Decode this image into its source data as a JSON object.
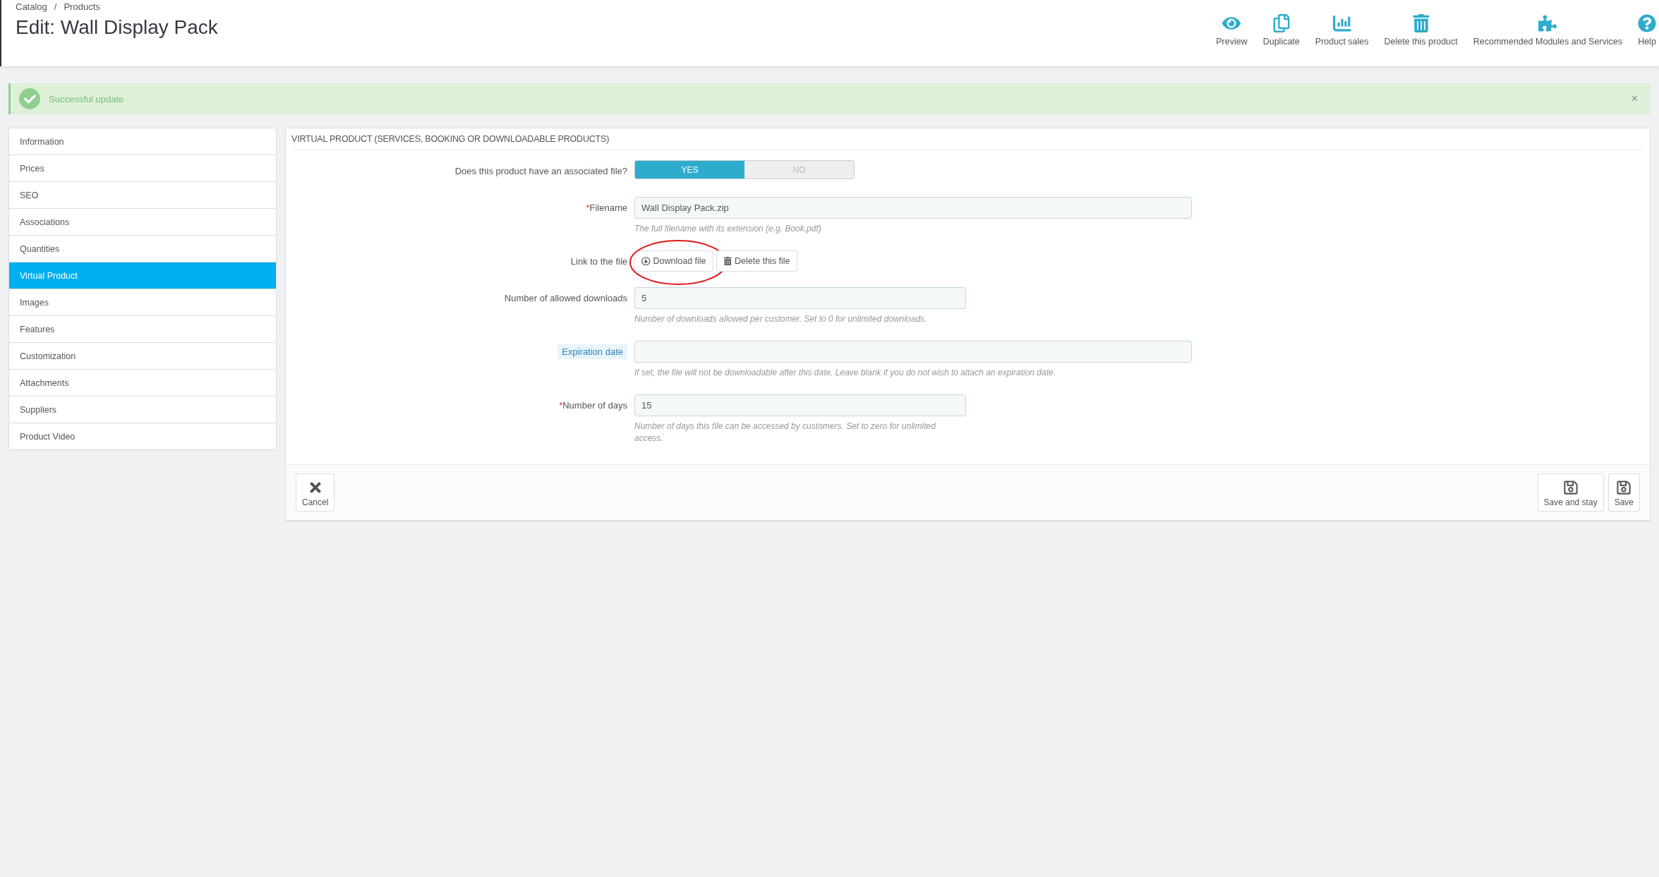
{
  "breadcrumb": {
    "items": [
      "Catalog",
      "Products"
    ],
    "separator": "/"
  },
  "title": "Edit: Wall Display Pack",
  "toolbar": [
    {
      "label": "Preview",
      "kind": "eye"
    },
    {
      "label": "Duplicate",
      "kind": "copy"
    },
    {
      "label": "Product sales",
      "kind": "chart"
    },
    {
      "label": "Delete this product",
      "kind": "trash"
    },
    {
      "label": "Recommended Modules and Services",
      "kind": "puzzle"
    },
    {
      "label": "Help",
      "kind": "help"
    }
  ],
  "alert": {
    "message": "Successful update",
    "close": "×"
  },
  "sidebar": {
    "items": [
      {
        "label": "Information",
        "selected": false
      },
      {
        "label": "Prices",
        "selected": false
      },
      {
        "label": "SEO",
        "selected": false
      },
      {
        "label": "Associations",
        "selected": false
      },
      {
        "label": "Quantities",
        "selected": false
      },
      {
        "label": "Virtual Product",
        "selected": true
      },
      {
        "label": "Images",
        "selected": false
      },
      {
        "label": "Features",
        "selected": false
      },
      {
        "label": "Customization",
        "selected": false
      },
      {
        "label": "Attachments",
        "selected": false
      },
      {
        "label": "Suppliers",
        "selected": false
      },
      {
        "label": "Product Video",
        "selected": false
      }
    ]
  },
  "panel": {
    "title": "VIRTUAL PRODUCT (SERVICES, BOOKING OR DOWNLOADABLE PRODUCTS)",
    "rows": [
      {
        "kind": "toggle",
        "label": "Does this product have an associated file?",
        "options": [
          {
            "label": "YES",
            "selected": true
          },
          {
            "label": "NO",
            "selected": false
          }
        ]
      },
      {
        "kind": "text",
        "label": "Filename",
        "required": "*",
        "value": "Wall Display Pack.zip",
        "hint": "The full filename with its extension (e.g. Book.pdf)"
      },
      {
        "kind": "buttons",
        "label": "Link to the file",
        "buttons": [
          {
            "label": "Download file",
            "kind": "download",
            "circled": true
          },
          {
            "label": "Delete this file",
            "kind": "trash",
            "circled": false
          }
        ]
      },
      {
        "kind": "short_text",
        "label": "Number of allowed downloads",
        "value": "5",
        "hint": "Number of downloads allowed per customer. Set to 0 for unlimited downloads."
      },
      {
        "kind": "text",
        "label": "Expiration date",
        "highlighted": true,
        "hint": "If set, the file will not be downloadable after this date. Leave blank if you do not wish to attach an expiration date."
      },
      {
        "kind": "short_text",
        "label": "Number of days",
        "required": "*",
        "value": "15",
        "hint": "Number of days this file can be accessed by customers. Set to zero for unlimited access."
      }
    ],
    "footer": {
      "left": [
        {
          "label": "Cancel",
          "kind": "cancel"
        }
      ],
      "right": [
        {
          "label": "Save and stay",
          "kind": "save"
        },
        {
          "label": "Save",
          "kind": "save"
        }
      ]
    }
  }
}
